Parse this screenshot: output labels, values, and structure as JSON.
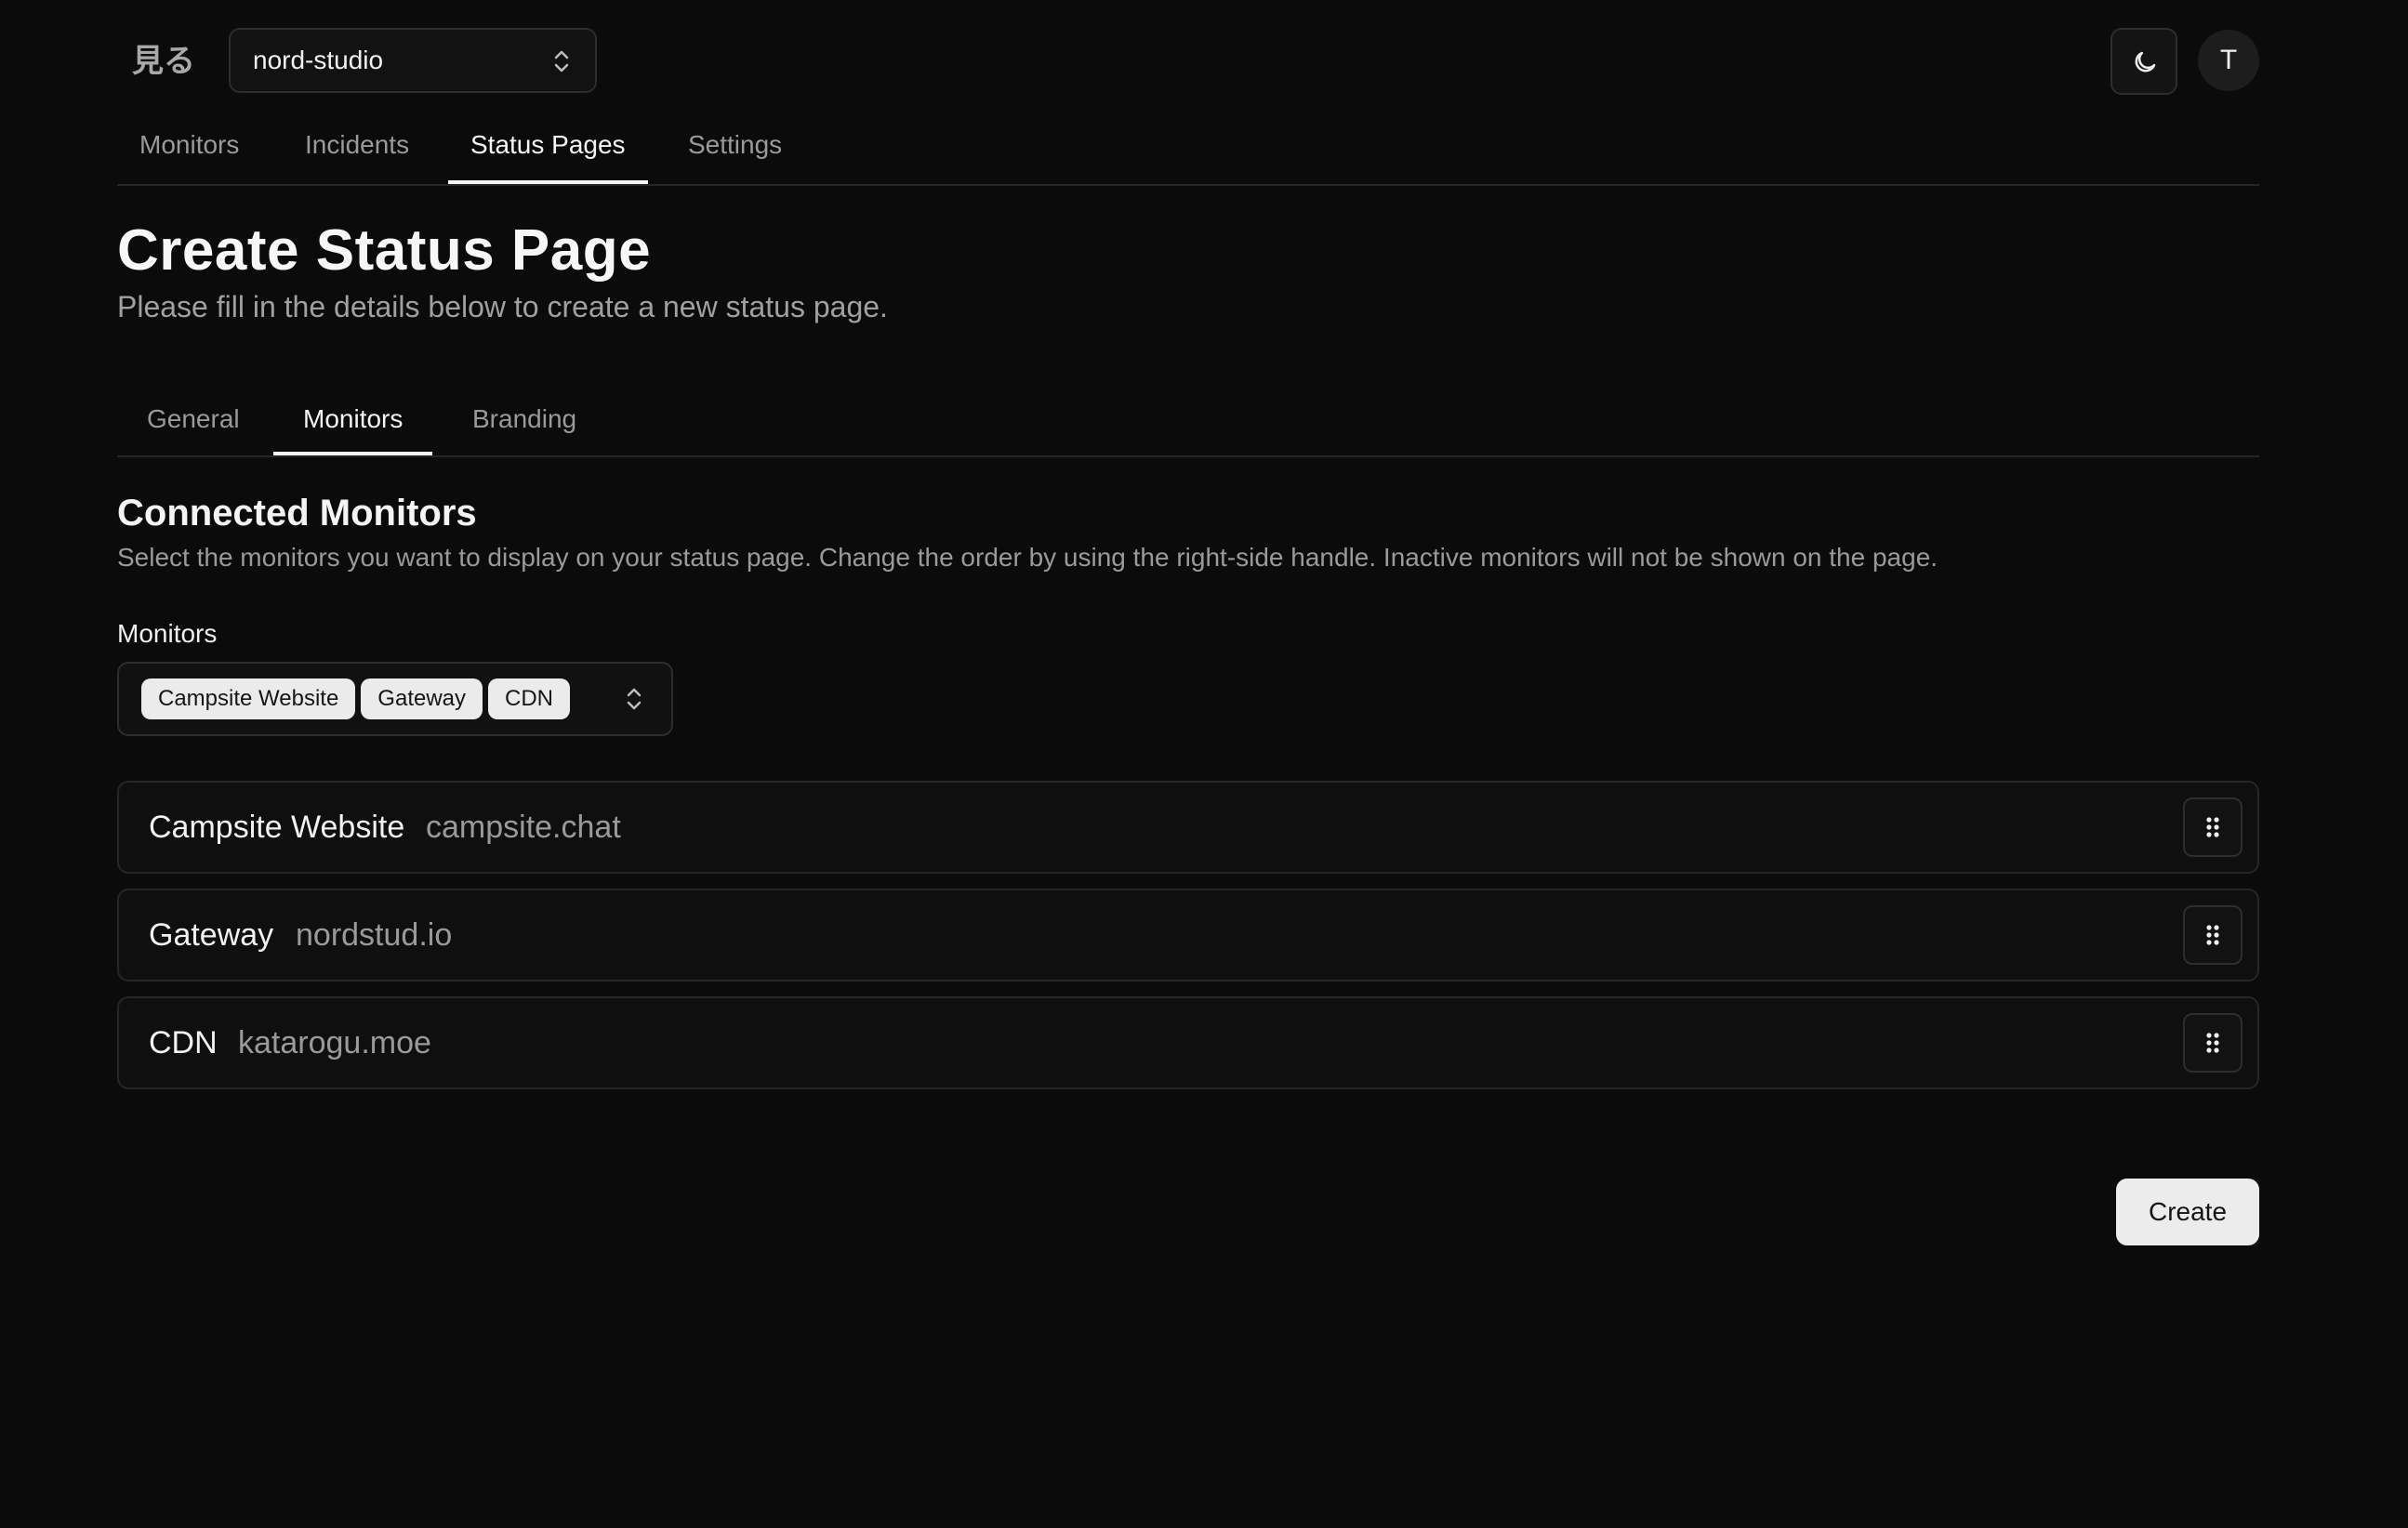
{
  "app": {
    "logo_text": "見る",
    "workspace": "nord-studio",
    "avatar_initial": "T"
  },
  "nav": {
    "tabs": [
      {
        "label": "Monitors",
        "active": false
      },
      {
        "label": "Incidents",
        "active": false
      },
      {
        "label": "Status Pages",
        "active": true
      },
      {
        "label": "Settings",
        "active": false
      }
    ]
  },
  "page": {
    "title": "Create Status Page",
    "subtitle": "Please fill in the details below to create a new status page."
  },
  "subtabs": [
    {
      "label": "General",
      "active": false
    },
    {
      "label": "Monitors",
      "active": true
    },
    {
      "label": "Branding",
      "active": false
    }
  ],
  "section": {
    "title": "Connected Monitors",
    "description": "Select the monitors you want to display on your status page. Change the order by using the right-side handle. Inactive monitors will not be shown on the page."
  },
  "field": {
    "label": "Monitors",
    "selected": [
      "Campsite Website",
      "Gateway",
      "CDN"
    ]
  },
  "monitors": [
    {
      "name": "Campsite Website",
      "url": "campsite.chat"
    },
    {
      "name": "Gateway",
      "url": "nordstud.io"
    },
    {
      "name": "CDN",
      "url": "katarogu.moe"
    }
  ],
  "actions": {
    "create_label": "Create"
  },
  "colors": {
    "background": "#0b0b0b",
    "border": "#2d2d2d",
    "text_primary": "#f2f2f2",
    "text_muted": "#9a9a9a",
    "chip_bg": "#ebebeb",
    "button_bg": "#ececec"
  },
  "icons": {
    "theme_toggle": "moon-icon",
    "select_chevron": "chevron-up-down-icon",
    "drag": "grip-vertical-icon"
  }
}
